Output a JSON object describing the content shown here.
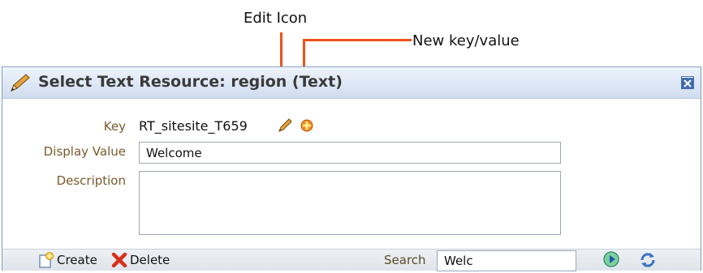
{
  "callouts": {
    "edit_icon": "Edit Icon",
    "new_key_value": "New key/value"
  },
  "dialog": {
    "title": "Select Text Resource: region (Text)",
    "key_label": "Key",
    "key_value": "RT_sitesite_T659",
    "display_value_label": "Display Value",
    "display_value": "Welcome",
    "description_label": "Description",
    "description_value": ""
  },
  "toolbar": {
    "create_label": "Create",
    "delete_label": "Delete",
    "search_label": "Search",
    "search_value": "Welc"
  },
  "colors": {
    "callout_line": "#f0501e",
    "header_bg": "#dde7f5",
    "label_text": "#7a5a2a"
  },
  "icons": [
    "pencil-icon",
    "add-icon",
    "close-icon",
    "create-icon",
    "delete-icon",
    "go-icon",
    "refresh-icon"
  ]
}
